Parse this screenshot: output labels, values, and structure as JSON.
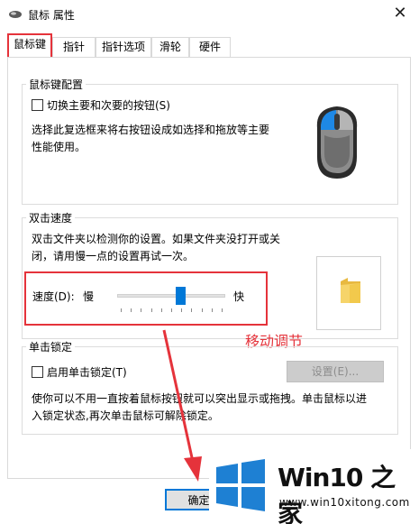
{
  "window": {
    "title": "鼠标 属性",
    "close_glyph": "✕"
  },
  "tabs": [
    {
      "label": "鼠标键",
      "active": true
    },
    {
      "label": "指针",
      "active": false
    },
    {
      "label": "指针选项",
      "active": false
    },
    {
      "label": "滑轮",
      "active": false
    },
    {
      "label": "硬件",
      "active": false
    }
  ],
  "button_config": {
    "title": "鼠标键配置",
    "checkbox_label": "切换主要和次要的按钮(S)",
    "checked": false,
    "description_line1": "选择此复选框来将右按钮设成如选择和拖放等主要",
    "description_line2": "性能使用。",
    "mouse_icon": "mouse-icon"
  },
  "double_click": {
    "title": "双击速度",
    "description_line1": "双击文件夹以检测你的设置。如果文件夹没打开或关",
    "description_line2": "闭，请用慢一点的设置再试一次。",
    "speed_label": "速度(D):",
    "slow_label": "慢",
    "fast_label": "快",
    "speed_fraction": 0.6,
    "folder_icon": "folder-icon"
  },
  "annotation": {
    "text": "移动调节",
    "color": "#e5333b"
  },
  "click_lock": {
    "title": "单击锁定",
    "checkbox_label": "启用单击锁定(T)",
    "checked": false,
    "settings_label": "设置(E)...",
    "description_line1": "使你可以不用一直按着鼠标按钮就可以突出显示或拖拽。单击鼠标以进",
    "description_line2": "入锁定状态,再次单击鼠标可解除锁定。"
  },
  "footer": {
    "ok_label": "确定"
  },
  "watermark": {
    "title": "Win10 之家",
    "url": "www.win10xitong.com"
  },
  "colors": {
    "accent": "#0078d7",
    "highlight": "#e5333b",
    "brand_blue": "#1e80d3"
  }
}
